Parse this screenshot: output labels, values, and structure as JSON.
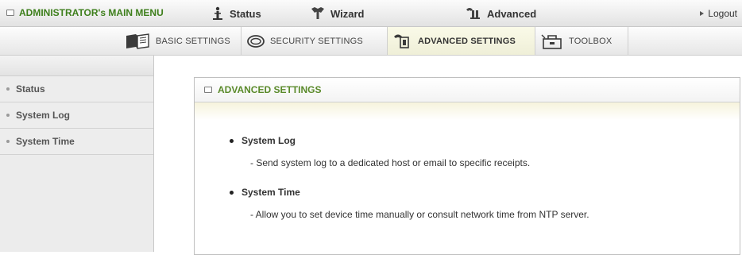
{
  "top_menu": {
    "title": "ADMINISTRATOR's MAIN MENU",
    "nav": [
      {
        "label": "Status",
        "icon": "status-icon"
      },
      {
        "label": "Wizard",
        "icon": "wizard-icon"
      },
      {
        "label": "Advanced",
        "icon": "advanced-icon"
      }
    ],
    "logout": "Logout"
  },
  "tabs": [
    {
      "label": "BASIC SETTINGS",
      "icon": "book-icon",
      "active": false
    },
    {
      "label": "SECURITY SETTINGS",
      "icon": "lock-icon",
      "active": false
    },
    {
      "label": "ADVANCED SETTINGS",
      "icon": "tools-icon",
      "active": true
    },
    {
      "label": "TOOLBOX",
      "icon": "toolbox-icon",
      "active": false
    }
  ],
  "sidebar": {
    "items": [
      {
        "label": "Status"
      },
      {
        "label": "System Log"
      },
      {
        "label": "System Time"
      }
    ]
  },
  "panel": {
    "title": "ADVANCED SETTINGS",
    "entries": [
      {
        "title": "System Log",
        "desc": "- Send system log to a dedicated host or email to specific receipts."
      },
      {
        "title": "System Time",
        "desc": "- Allow you to set device time manually or consult network time from NTP server."
      }
    ]
  },
  "colors": {
    "accent_green": "#3e7f1c",
    "active_tab_bg": "#efefd8"
  }
}
